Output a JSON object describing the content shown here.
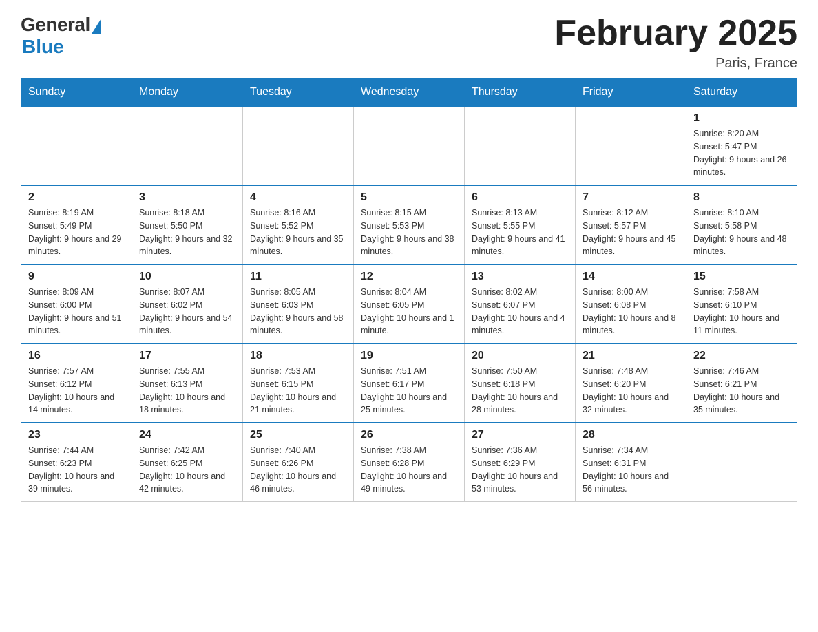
{
  "header": {
    "logo": {
      "general": "General",
      "blue": "Blue"
    },
    "title": "February 2025",
    "location": "Paris, France"
  },
  "weekdays": [
    "Sunday",
    "Monday",
    "Tuesday",
    "Wednesday",
    "Thursday",
    "Friday",
    "Saturday"
  ],
  "weeks": [
    [
      {
        "day": "",
        "info": ""
      },
      {
        "day": "",
        "info": ""
      },
      {
        "day": "",
        "info": ""
      },
      {
        "day": "",
        "info": ""
      },
      {
        "day": "",
        "info": ""
      },
      {
        "day": "",
        "info": ""
      },
      {
        "day": "1",
        "info": "Sunrise: 8:20 AM\nSunset: 5:47 PM\nDaylight: 9 hours and 26 minutes."
      }
    ],
    [
      {
        "day": "2",
        "info": "Sunrise: 8:19 AM\nSunset: 5:49 PM\nDaylight: 9 hours and 29 minutes."
      },
      {
        "day": "3",
        "info": "Sunrise: 8:18 AM\nSunset: 5:50 PM\nDaylight: 9 hours and 32 minutes."
      },
      {
        "day": "4",
        "info": "Sunrise: 8:16 AM\nSunset: 5:52 PM\nDaylight: 9 hours and 35 minutes."
      },
      {
        "day": "5",
        "info": "Sunrise: 8:15 AM\nSunset: 5:53 PM\nDaylight: 9 hours and 38 minutes."
      },
      {
        "day": "6",
        "info": "Sunrise: 8:13 AM\nSunset: 5:55 PM\nDaylight: 9 hours and 41 minutes."
      },
      {
        "day": "7",
        "info": "Sunrise: 8:12 AM\nSunset: 5:57 PM\nDaylight: 9 hours and 45 minutes."
      },
      {
        "day": "8",
        "info": "Sunrise: 8:10 AM\nSunset: 5:58 PM\nDaylight: 9 hours and 48 minutes."
      }
    ],
    [
      {
        "day": "9",
        "info": "Sunrise: 8:09 AM\nSunset: 6:00 PM\nDaylight: 9 hours and 51 minutes."
      },
      {
        "day": "10",
        "info": "Sunrise: 8:07 AM\nSunset: 6:02 PM\nDaylight: 9 hours and 54 minutes."
      },
      {
        "day": "11",
        "info": "Sunrise: 8:05 AM\nSunset: 6:03 PM\nDaylight: 9 hours and 58 minutes."
      },
      {
        "day": "12",
        "info": "Sunrise: 8:04 AM\nSunset: 6:05 PM\nDaylight: 10 hours and 1 minute."
      },
      {
        "day": "13",
        "info": "Sunrise: 8:02 AM\nSunset: 6:07 PM\nDaylight: 10 hours and 4 minutes."
      },
      {
        "day": "14",
        "info": "Sunrise: 8:00 AM\nSunset: 6:08 PM\nDaylight: 10 hours and 8 minutes."
      },
      {
        "day": "15",
        "info": "Sunrise: 7:58 AM\nSunset: 6:10 PM\nDaylight: 10 hours and 11 minutes."
      }
    ],
    [
      {
        "day": "16",
        "info": "Sunrise: 7:57 AM\nSunset: 6:12 PM\nDaylight: 10 hours and 14 minutes."
      },
      {
        "day": "17",
        "info": "Sunrise: 7:55 AM\nSunset: 6:13 PM\nDaylight: 10 hours and 18 minutes."
      },
      {
        "day": "18",
        "info": "Sunrise: 7:53 AM\nSunset: 6:15 PM\nDaylight: 10 hours and 21 minutes."
      },
      {
        "day": "19",
        "info": "Sunrise: 7:51 AM\nSunset: 6:17 PM\nDaylight: 10 hours and 25 minutes."
      },
      {
        "day": "20",
        "info": "Sunrise: 7:50 AM\nSunset: 6:18 PM\nDaylight: 10 hours and 28 minutes."
      },
      {
        "day": "21",
        "info": "Sunrise: 7:48 AM\nSunset: 6:20 PM\nDaylight: 10 hours and 32 minutes."
      },
      {
        "day": "22",
        "info": "Sunrise: 7:46 AM\nSunset: 6:21 PM\nDaylight: 10 hours and 35 minutes."
      }
    ],
    [
      {
        "day": "23",
        "info": "Sunrise: 7:44 AM\nSunset: 6:23 PM\nDaylight: 10 hours and 39 minutes."
      },
      {
        "day": "24",
        "info": "Sunrise: 7:42 AM\nSunset: 6:25 PM\nDaylight: 10 hours and 42 minutes."
      },
      {
        "day": "25",
        "info": "Sunrise: 7:40 AM\nSunset: 6:26 PM\nDaylight: 10 hours and 46 minutes."
      },
      {
        "day": "26",
        "info": "Sunrise: 7:38 AM\nSunset: 6:28 PM\nDaylight: 10 hours and 49 minutes."
      },
      {
        "day": "27",
        "info": "Sunrise: 7:36 AM\nSunset: 6:29 PM\nDaylight: 10 hours and 53 minutes."
      },
      {
        "day": "28",
        "info": "Sunrise: 7:34 AM\nSunset: 6:31 PM\nDaylight: 10 hours and 56 minutes."
      },
      {
        "day": "",
        "info": ""
      }
    ]
  ]
}
